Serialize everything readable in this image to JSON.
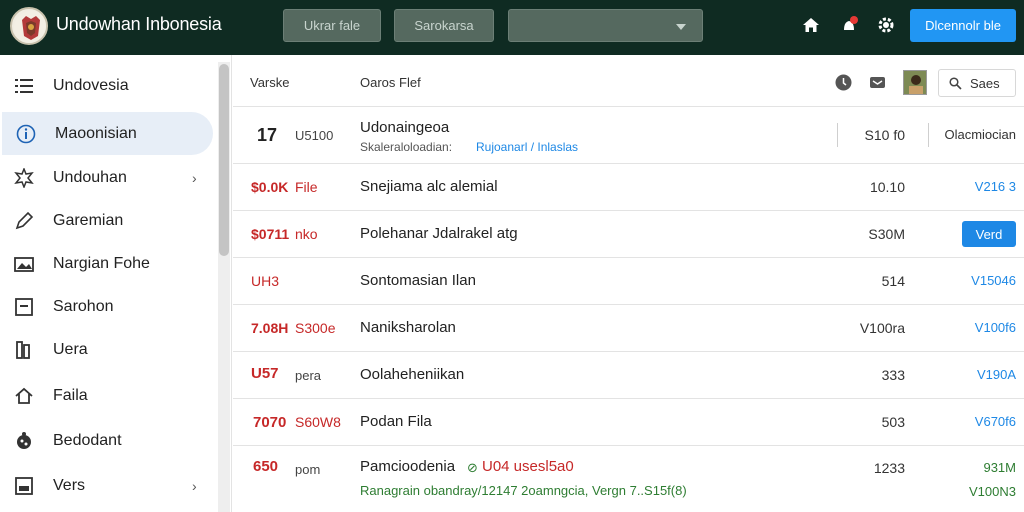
{
  "header": {
    "title": "Undowhan Inbonesia",
    "button1_label": "Ukrar fale",
    "button2_label": "Sarokarsa",
    "select_value": "",
    "primary_label": "Dlcennolr ble",
    "accent": "#2196f3",
    "bar_color": "#0f2b22"
  },
  "sidebar": {
    "items": [
      {
        "label": "Undovesia",
        "icon": "list-icon"
      },
      {
        "label": "Maoonisian",
        "icon": "info-icon",
        "active": true
      },
      {
        "label": "Undouhan",
        "icon": "settings-icon",
        "chevron": "›"
      },
      {
        "label": "Garemian",
        "icon": "pen-icon"
      },
      {
        "label": "Nargian Fohe",
        "icon": "image-icon"
      },
      {
        "label": "Sarohon",
        "icon": "box-icon"
      },
      {
        "label": "Uera",
        "icon": "book-icon"
      },
      {
        "label": "Faila",
        "icon": "home-icon"
      },
      {
        "label": "Bedodant",
        "icon": "palette-icon"
      },
      {
        "label": "Vers",
        "icon": "grid-icon",
        "chevron": "›"
      }
    ]
  },
  "table": {
    "header": {
      "col1": "Varske",
      "col2": "Oaros Flef",
      "search_label": "Saes"
    },
    "rows": [
      {
        "code": "17",
        "sub": "U5100",
        "name": "Udonaingeoa",
        "detail_prefix": "Skaleraloloadian:",
        "detail_link": "Rujoanarl / Inlaslas",
        "value": "S10 f0",
        "version": "Olacmiocian"
      },
      {
        "code": "$0.0K",
        "sub": "File",
        "name": "Snejiama alc alemial",
        "value": "10.10",
        "version": "V216 3"
      },
      {
        "code": "$0711",
        "sub": "nko",
        "name": "Polehanar Jdalrakel atg",
        "value": "S30M",
        "button": "Verd"
      },
      {
        "code": "UH3",
        "sub": "",
        "name": "Sontomasian Ilan",
        "value": "514",
        "version": "V15046"
      },
      {
        "code": "7.08H",
        "sub": "S300e",
        "name": "Naniksharolan",
        "value": "V100ra",
        "version": "V100f6"
      },
      {
        "code": "U57",
        "sub": "pera",
        "name": "Oolaheheniikan",
        "value": "333",
        "version": "V190A"
      },
      {
        "code": "7070",
        "sub": "S60W8",
        "name": "Podan Fila",
        "value": "503",
        "version": "V670f6"
      },
      {
        "code": "650",
        "sub": "pom",
        "name": "Pamcioodenia",
        "name_suffix": "U04 usesl5a0",
        "detail_green": "Ranagrain obandray/12147 2oamngcia, Vergn 7..S15f(8)",
        "value": "1233",
        "value2": "931M",
        "version": "V100N3"
      }
    ]
  }
}
